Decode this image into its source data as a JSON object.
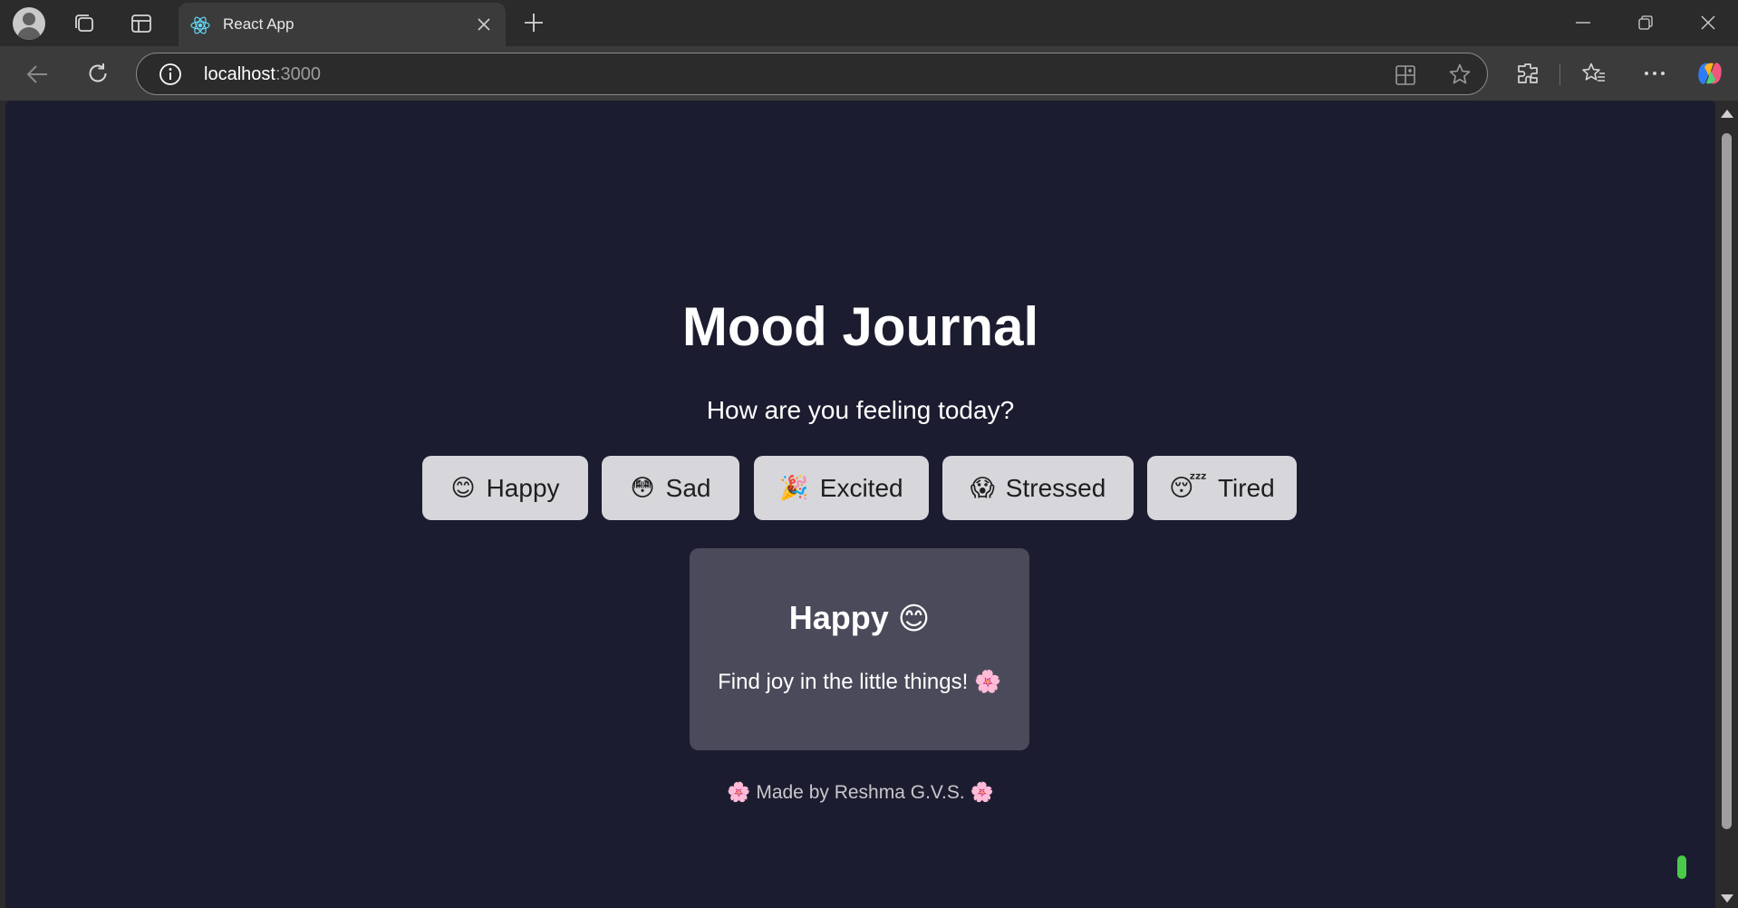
{
  "browser": {
    "tab": {
      "title": "React App"
    },
    "url": {
      "host": "localhost",
      "port": ":3000"
    }
  },
  "page": {
    "title": "Mood Journal",
    "question": "How are you feeling today?",
    "moods": [
      {
        "emoji": "😊",
        "label": "Happy"
      },
      {
        "emoji": "😳",
        "label": "Sad"
      },
      {
        "emoji": "🎉",
        "label": "Excited"
      },
      {
        "emoji": "😱",
        "label": "Stressed"
      },
      {
        "emoji": "😴",
        "label": "Tired"
      }
    ],
    "card": {
      "title": "Happy",
      "title_emoji": "😊",
      "message": "Find joy in the little things!",
      "message_emoji": "🌸"
    },
    "footer": {
      "prefix_emoji": "🌸",
      "text": "Made by Reshma G.V.S.",
      "suffix_emoji": "🌸"
    }
  },
  "colors": {
    "page_bg": "#1c1c30",
    "button_bg": "#d6d6db",
    "card_bg": "#4a4a5a",
    "accent_green": "#4ac94a"
  }
}
